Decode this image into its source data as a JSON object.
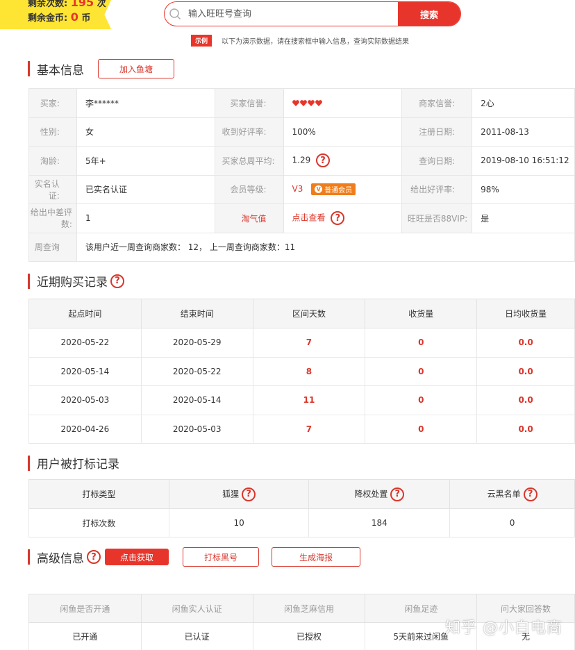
{
  "top": {
    "remaining_count_label": "剩余次数:",
    "remaining_count_value": "195",
    "remaining_count_unit": "次",
    "remaining_coin_label": "剩余金币:",
    "remaining_coin_value": "0",
    "remaining_coin_unit": "币",
    "search_placeholder": "输入旺旺号查询",
    "search_button": "搜索",
    "demo_tag": "示例",
    "demo_text": "以下为演示数据，请在搜索框中输入信息，查询实际数据结果"
  },
  "basic": {
    "title": "基本信息",
    "add_button": "加入鱼塘",
    "rows": [
      [
        {
          "label": "买家:",
          "value": "李******"
        },
        {
          "label": "买家信誉:",
          "value": ""
        },
        {
          "label": "商家信誉:",
          "value": "2心"
        }
      ],
      [
        {
          "label": "性别:",
          "value": "女"
        },
        {
          "label": "收到好评率:",
          "value": "100%"
        },
        {
          "label": "注册日期:",
          "value": "2011-08-13"
        }
      ],
      [
        {
          "label": "淘龄:",
          "value": "5年+"
        },
        {
          "label": "买家总周平均:",
          "value": "1.29"
        },
        {
          "label": "查询日期:",
          "value": "2019-08-10 16:51:12"
        }
      ],
      [
        {
          "label": "实名认证:",
          "value": "已实名认证"
        },
        {
          "label": "会员等级:",
          "value": "V3"
        },
        {
          "label": "给出好评率:",
          "value": "98%"
        }
      ],
      [
        {
          "label": "给出中差评数:",
          "value": "1"
        },
        {
          "label": "淘气值",
          "value": "点击查看"
        },
        {
          "label": "旺旺是否88VIP:",
          "value": "是"
        }
      ]
    ],
    "member_badge": "普通会员",
    "week_label": "周查询",
    "week_value": "该用户近一周查询商家数： 12， 上一周查询商家数：11"
  },
  "purchase": {
    "title": "近期购买记录",
    "headers": [
      "起点时间",
      "结束时间",
      "区间天数",
      "收货量",
      "日均收货量"
    ],
    "rows": [
      [
        "2020-05-22",
        "2020-05-29",
        "7",
        "0",
        "0.0"
      ],
      [
        "2020-05-14",
        "2020-05-22",
        "8",
        "0",
        "0.0"
      ],
      [
        "2020-05-03",
        "2020-05-14",
        "11",
        "0",
        "0.0"
      ],
      [
        "2020-04-26",
        "2020-05-03",
        "7",
        "0",
        "0.0"
      ]
    ]
  },
  "tag": {
    "title": "用户被打标记录",
    "headers": [
      "打标类型",
      "狐狸",
      "降权处置",
      "云黑名单"
    ],
    "row": [
      "打标次数",
      "10",
      "184",
      "0"
    ]
  },
  "advanced": {
    "title": "高级信息",
    "get_button": "点击获取",
    "blacklist_button": "打标黑号",
    "poster_button": "生成海报",
    "headers": [
      "闲鱼是否开通",
      "闲鱼实人认证",
      "闲鱼芝麻信用",
      "闲鱼足迹",
      "问大家回答数"
    ],
    "row": [
      "已开通",
      "已认证",
      "已授权",
      "5天前来过闲鱼",
      "无"
    ]
  },
  "watermark": "知乎 @小白电商",
  "colors": {
    "accent": "#e8352b",
    "badge_yellow": "#ffe533",
    "member_orange": "#f07d1a"
  }
}
